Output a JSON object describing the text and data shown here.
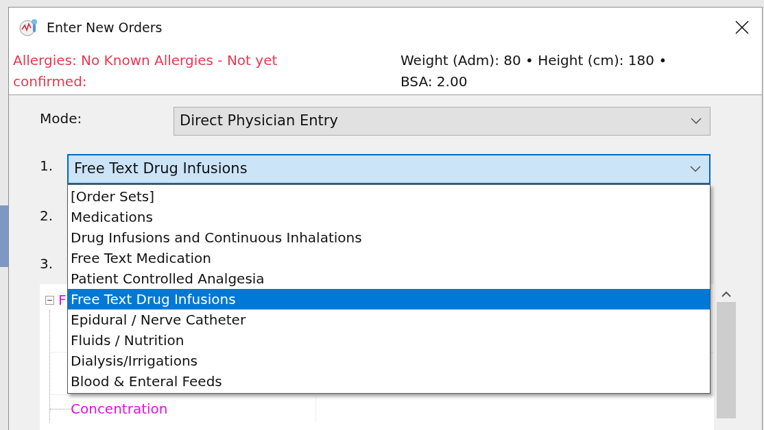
{
  "window": {
    "title": "Enter New Orders"
  },
  "patient_banner": {
    "allergies": "Allergies: No Known Allergies - Not yet confirmed:",
    "measurements": "Weight (Adm): 80 • Height (cm): 180 • BSA: 2.00"
  },
  "mode": {
    "label": "Mode:",
    "value": "Direct Physician Entry"
  },
  "order_rows": [
    {
      "number": "1.",
      "value": "Free Text Drug Infusions",
      "expanded": true
    },
    {
      "number": "2."
    },
    {
      "number": "3."
    }
  ],
  "dropdown_options": [
    {
      "label": "[Order Sets]",
      "selected": false
    },
    {
      "label": "Medications",
      "selected": false
    },
    {
      "label": "Drug Infusions and Continuous Inhalations",
      "selected": false
    },
    {
      "label": "Free Text Medication",
      "selected": false
    },
    {
      "label": "Patient Controlled Analgesia",
      "selected": false
    },
    {
      "label": "Free Text Drug Infusions",
      "selected": true
    },
    {
      "label": "Epidural / Nerve Catheter",
      "selected": false
    },
    {
      "label": "Fluids / Nutrition",
      "selected": false
    },
    {
      "label": "Dialysis/Irrigations",
      "selected": false
    },
    {
      "label": "Blood & Enteral Feeds",
      "selected": false
    }
  ],
  "tree": {
    "label": "F",
    "expanded": true,
    "children": [
      {
        "label": "Concentration"
      }
    ]
  }
}
